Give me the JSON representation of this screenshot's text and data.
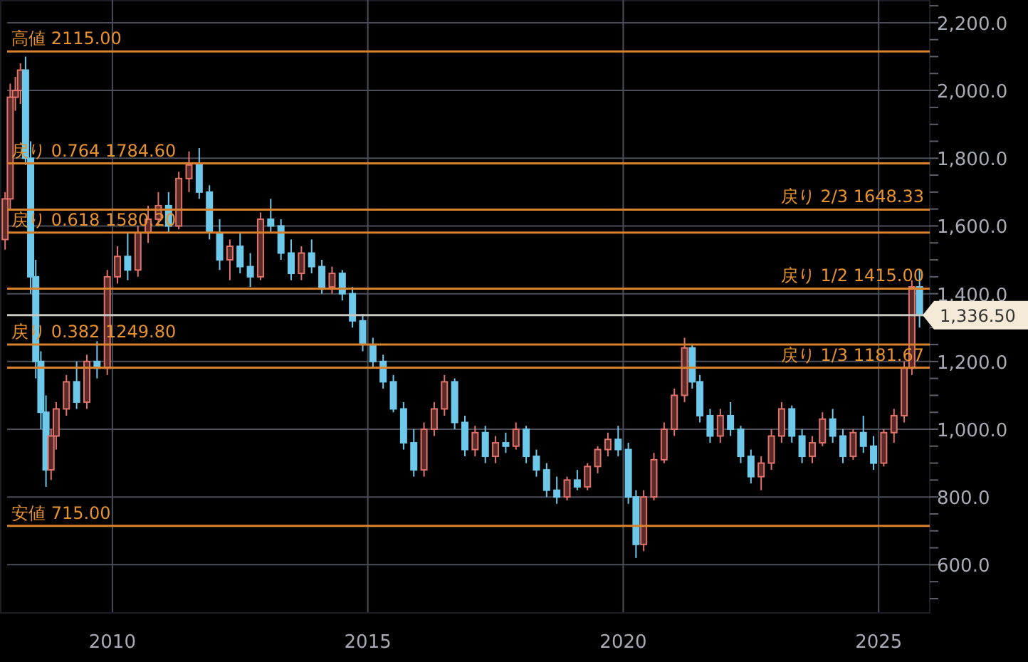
{
  "chart": {
    "levels": [
      {
        "kind": "extreme"
      },
      {
        "kind": "ratio"
      },
      {
        "kind": "fraction"
      },
      {
        "kind": "ratio"
      },
      {
        "kind": "fraction"
      },
      {
        "kind": "current"
      },
      {
        "kind": "ratio"
      },
      {
        "kind": "fraction"
      },
      {
        "kind": "extreme"
      }
    ],
    "chart_data": {
      "type": "candlestick",
      "grid": true,
      "ref_lines": [
        {
          "axis": "y",
          "value": 2115.0,
          "label": "高値 2115.00",
          "color": "#d9822b"
        },
        {
          "axis": "y",
          "value": 1784.6,
          "label": "戻り 0.764 1784.60",
          "color": "#d9822b"
        },
        {
          "axis": "y",
          "value": 1648.33,
          "label": "戻り 2/3 1648.33",
          "color": "#d9822b"
        },
        {
          "axis": "y",
          "value": 1580.2,
          "label": "戻り 0.618 1580.20",
          "color": "#d9822b"
        },
        {
          "axis": "y",
          "value": 1415.0,
          "label": "戻り 1/2 1415.00",
          "color": "#d9822b"
        },
        {
          "axis": "y",
          "value": 1336.5,
          "label": "1,336.50",
          "color": "#c8c8c0"
        },
        {
          "axis": "y",
          "value": 1249.8,
          "label": "戻り 0.382 1249.80",
          "color": "#d9822b"
        },
        {
          "axis": "y",
          "value": 1181.67,
          "label": "戻り 1/3 1181.67",
          "color": "#d9822b"
        },
        {
          "axis": "y",
          "value": 715.0,
          "label": "安値 715.00",
          "color": "#d9822b"
        }
      ],
      "xlim": [
        2007.8,
        2026.0
      ],
      "x": [
        2007.9,
        2008.0,
        2008.1,
        2008.2,
        2008.3,
        2008.4,
        2008.5,
        2008.6,
        2008.7,
        2008.8,
        2008.9,
        2009.1,
        2009.3,
        2009.5,
        2009.7,
        2009.9,
        2010.1,
        2010.3,
        2010.5,
        2010.7,
        2010.9,
        2011.1,
        2011.3,
        2011.5,
        2011.7,
        2011.9,
        2012.1,
        2012.3,
        2012.5,
        2012.7,
        2012.9,
        2013.1,
        2013.3,
        2013.5,
        2013.7,
        2013.9,
        2014.1,
        2014.3,
        2014.5,
        2014.7,
        2014.9,
        2015.1,
        2015.3,
        2015.5,
        2015.7,
        2015.9,
        2016.1,
        2016.3,
        2016.5,
        2016.7,
        2016.9,
        2017.1,
        2017.3,
        2017.5,
        2017.7,
        2017.9,
        2018.1,
        2018.3,
        2018.5,
        2018.7,
        2018.9,
        2019.1,
        2019.3,
        2019.5,
        2019.7,
        2019.9,
        2020.1,
        2020.25,
        2020.4,
        2020.6,
        2020.8,
        2021.0,
        2021.2,
        2021.35,
        2021.5,
        2021.7,
        2021.9,
        2022.1,
        2022.3,
        2022.5,
        2022.7,
        2022.9,
        2023.1,
        2023.3,
        2023.5,
        2023.7,
        2023.9,
        2024.1,
        2024.3,
        2024.5,
        2024.7,
        2024.9,
        2025.1,
        2025.3,
        2025.5,
        2025.65,
        2025.8
      ],
      "ohlc": [
        [
          1560,
          1700,
          1530,
          1680
        ],
        [
          1680,
          2020,
          1650,
          1980
        ],
        [
          1980,
          2040,
          1940,
          2000
        ],
        [
          2000,
          2080,
          1960,
          2060
        ],
        [
          2060,
          2100,
          1780,
          1800
        ],
        [
          1800,
          1850,
          1400,
          1450
        ],
        [
          1450,
          1500,
          1150,
          1200
        ],
        [
          1200,
          1230,
          1000,
          1050
        ],
        [
          1050,
          1100,
          830,
          880
        ],
        [
          880,
          1000,
          850,
          980
        ],
        [
          980,
          1080,
          940,
          1060
        ],
        [
          1060,
          1160,
          1040,
          1140
        ],
        [
          1140,
          1200,
          1060,
          1080
        ],
        [
          1080,
          1220,
          1060,
          1200
        ],
        [
          1200,
          1260,
          1150,
          1180
        ],
        [
          1180,
          1470,
          1160,
          1450
        ],
        [
          1450,
          1540,
          1430,
          1510
        ],
        [
          1510,
          1580,
          1440,
          1470
        ],
        [
          1470,
          1600,
          1450,
          1580
        ],
        [
          1580,
          1660,
          1550,
          1620
        ],
        [
          1620,
          1700,
          1600,
          1660
        ],
        [
          1660,
          1700,
          1580,
          1600
        ],
        [
          1600,
          1760,
          1590,
          1740
        ],
        [
          1740,
          1820,
          1700,
          1780
        ],
        [
          1780,
          1830,
          1680,
          1700
        ],
        [
          1700,
          1720,
          1560,
          1580
        ],
        [
          1580,
          1620,
          1470,
          1500
        ],
        [
          1500,
          1560,
          1440,
          1540
        ],
        [
          1540,
          1580,
          1460,
          1480
        ],
        [
          1480,
          1520,
          1420,
          1450
        ],
        [
          1450,
          1640,
          1440,
          1620
        ],
        [
          1620,
          1680,
          1580,
          1600
        ],
        [
          1600,
          1620,
          1500,
          1520
        ],
        [
          1520,
          1560,
          1440,
          1460
        ],
        [
          1460,
          1540,
          1440,
          1520
        ],
        [
          1520,
          1560,
          1460,
          1480
        ],
        [
          1480,
          1500,
          1400,
          1420
        ],
        [
          1420,
          1480,
          1400,
          1460
        ],
        [
          1460,
          1470,
          1380,
          1400
        ],
        [
          1400,
          1420,
          1300,
          1320
        ],
        [
          1320,
          1340,
          1230,
          1250
        ],
        [
          1250,
          1270,
          1180,
          1200
        ],
        [
          1200,
          1220,
          1120,
          1140
        ],
        [
          1140,
          1160,
          1050,
          1060
        ],
        [
          1060,
          1080,
          940,
          960
        ],
        [
          960,
          1000,
          860,
          880
        ],
        [
          880,
          1020,
          860,
          1000
        ],
        [
          1000,
          1080,
          980,
          1060
        ],
        [
          1060,
          1160,
          1040,
          1140
        ],
        [
          1140,
          1150,
          1000,
          1020
        ],
        [
          1020,
          1040,
          920,
          940
        ],
        [
          940,
          1010,
          920,
          990
        ],
        [
          990,
          1010,
          900,
          920
        ],
        [
          920,
          980,
          900,
          960
        ],
        [
          960,
          990,
          930,
          950
        ],
        [
          950,
          1020,
          940,
          1000
        ],
        [
          1000,
          1010,
          900,
          920
        ],
        [
          920,
          940,
          860,
          880
        ],
        [
          880,
          900,
          800,
          820
        ],
        [
          820,
          860,
          780,
          800
        ],
        [
          800,
          860,
          790,
          850
        ],
        [
          850,
          880,
          820,
          830
        ],
        [
          830,
          900,
          820,
          890
        ],
        [
          890,
          950,
          870,
          940
        ],
        [
          940,
          990,
          920,
          970
        ],
        [
          970,
          1010,
          920,
          940
        ],
        [
          940,
          960,
          780,
          800
        ],
        [
          800,
          820,
          620,
          660
        ],
        [
          660,
          820,
          640,
          800
        ],
        [
          800,
          930,
          790,
          910
        ],
        [
          910,
          1020,
          900,
          1000
        ],
        [
          1000,
          1120,
          980,
          1100
        ],
        [
          1100,
          1270,
          1080,
          1240
        ],
        [
          1240,
          1250,
          1120,
          1140
        ],
        [
          1140,
          1160,
          1020,
          1040
        ],
        [
          1040,
          1060,
          960,
          980
        ],
        [
          980,
          1060,
          960,
          1040
        ],
        [
          1040,
          1080,
          980,
          1000
        ],
        [
          1000,
          1010,
          900,
          920
        ],
        [
          920,
          940,
          840,
          860
        ],
        [
          860,
          920,
          820,
          900
        ],
        [
          900,
          1000,
          880,
          980
        ],
        [
          980,
          1080,
          960,
          1060
        ],
        [
          1060,
          1070,
          960,
          980
        ],
        [
          980,
          1000,
          900,
          920
        ],
        [
          920,
          980,
          900,
          960
        ],
        [
          960,
          1050,
          950,
          1030
        ],
        [
          1030,
          1060,
          960,
          980
        ],
        [
          980,
          1000,
          900,
          920
        ],
        [
          920,
          1000,
          910,
          990
        ],
        [
          990,
          1040,
          930,
          950
        ],
        [
          950,
          980,
          880,
          900
        ],
        [
          900,
          1000,
          890,
          990
        ],
        [
          990,
          1060,
          960,
          1040
        ],
        [
          1040,
          1200,
          1020,
          1180
        ],
        [
          1180,
          1440,
          1160,
          1420
        ],
        [
          1420,
          1470,
          1300,
          1336
        ]
      ],
      "ylim": [
        460,
        2267
      ],
      "xticks": [
        2010,
        2015,
        2020,
        2025
      ],
      "yticks": [
        {
          "value": 2200,
          "label": "2,200.0"
        },
        {
          "value": 2000,
          "label": "2,000.0"
        },
        {
          "value": 1800,
          "label": "1,800.0"
        },
        {
          "value": 1600,
          "label": "1,600.0"
        },
        {
          "value": 1400,
          "label": "1,400.0"
        },
        {
          "value": 1200,
          "label": "1,200.0"
        },
        {
          "value": 1000,
          "label": "1,000.0"
        },
        {
          "value": 800,
          "label": "800.0"
        },
        {
          "value": 600,
          "label": "600.0"
        }
      ]
    }
  }
}
